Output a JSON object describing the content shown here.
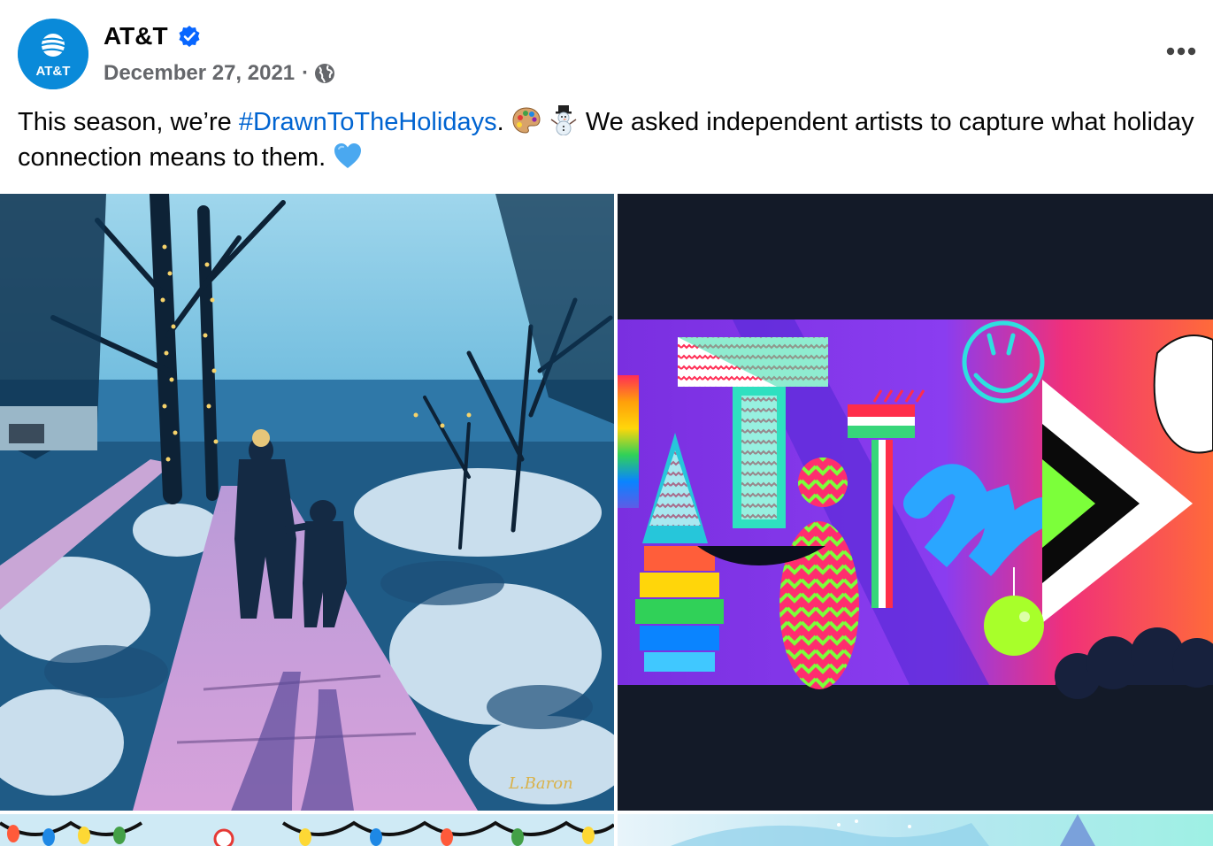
{
  "post": {
    "author": {
      "name": "AT&T",
      "avatar_text": "AT&T",
      "verified": true,
      "verified_icon": "verified-badge-icon"
    },
    "date": "December 27, 2021",
    "separator": "·",
    "audience_icon": "globe-icon",
    "more_icon": "ellipsis-icon",
    "text_before": "This season, we’re ",
    "hashtag": "#DrawnToTheHolidays",
    "text_mid": ". ",
    "emoji_1": "artist-palette-emoji",
    "emoji_2": "snowman-emoji",
    "text_after": " We asked independent artists to capture what holiday connection means to them. ",
    "emoji_3": "blue-heart-emoji",
    "photos": [
      {
        "name": "snowy-walk-painting",
        "signature": "L.Baron"
      },
      {
        "name": "colorful-att-artwork"
      },
      {
        "name": "holiday-lights-artwork"
      },
      {
        "name": "winter-artwork"
      }
    ]
  },
  "colors": {
    "brand": "#0a8ad9",
    "link": "#0064d1",
    "meta": "#65676b",
    "verified": "#0866ff"
  }
}
